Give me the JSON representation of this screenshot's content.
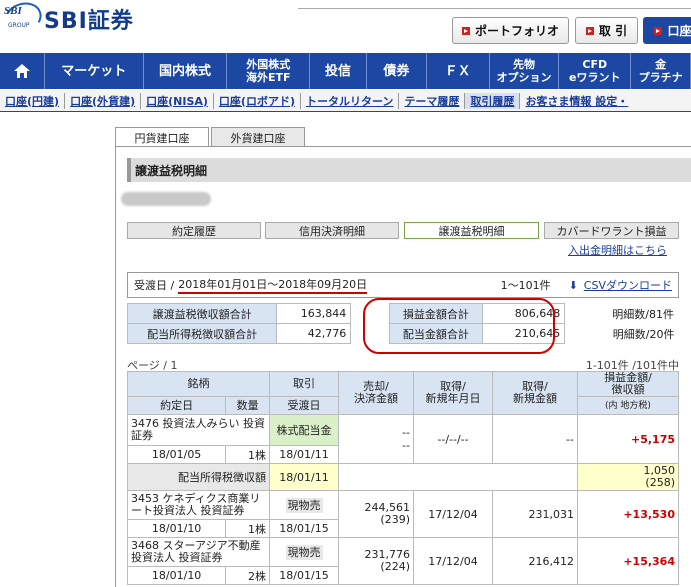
{
  "header": {
    "logo_small": "SBI",
    "logo_group": "GROUP",
    "logo_main": "SBI証券",
    "buttons": [
      {
        "label": "ポートフォリオ"
      },
      {
        "label": "取 引"
      },
      {
        "label": "口座"
      }
    ]
  },
  "nav": [
    "マーケット",
    "国内株式",
    "外国株式\n海外ETF",
    "投信",
    "債券",
    "ＦＸ",
    "先物\nオプション",
    "CFD\neワラント",
    "金\nプラチナ"
  ],
  "subnav": [
    "口座(円建)",
    "口座(外貨建)",
    "口座(NISA)",
    "口座(ロボアド)",
    "トータルリターン",
    "テーマ履歴",
    "取引履歴",
    "お客さま情報 設定・"
  ],
  "tabs": {
    "yen": "円貨建口座",
    "foreign": "外貨建口座"
  },
  "section_title": "譲渡益税明細",
  "subtabs": [
    "約定履歴",
    "信用決済明細",
    "譲渡益税明細",
    "カバードワラント損益"
  ],
  "deposit_link": "入出金明細はこちら",
  "filter": {
    "label": "受渡日 /",
    "range": "2018年01月01日〜2018年09月20日",
    "count": "1〜101件",
    "csv": "CSVダウンロード"
  },
  "summary": {
    "row1": {
      "l1": "譲渡益税徴収額合計",
      "v1": "163,844",
      "l2": "損益金額合計",
      "v2": "806,648",
      "d": "明細数/81件"
    },
    "row2": {
      "l1": "配当所得税徴収額合計",
      "v1": "42,776",
      "l2": "配当金額合計",
      "v2": "210,645",
      "d": "明細数/20件"
    }
  },
  "paging": {
    "page": "ページ / 1",
    "range": "1-101件 /101件中"
  },
  "table": {
    "h_meigara": "銘柄",
    "h_torihiki": "取引",
    "h_baikyaku": "売却/\n決済金額",
    "h_shutoku_date": "取得/\n新規年月日",
    "h_shutoku_amt": "取得/\n新規金額",
    "h_soneki": "損益金額/\n徴収額",
    "h_yakujo": "約定日",
    "h_suryo": "数量",
    "h_ukewatashi": "受渡日",
    "h_hiyo": "(費用)",
    "h_uchi": "(内 地方税)",
    "rows": [
      {
        "name": "3476 投資法人みらい 投資証券",
        "tr": "株式配当金",
        "sell": "--\n--",
        "acqd": "--/--/--",
        "acqa": "--",
        "pl": "+5,175",
        "date": "18/01/05",
        "qty": "1株",
        "ud": "18/01/11"
      },
      {
        "tax_label": "配当所得税徴収額",
        "tax_date": "18/01/11",
        "tax_val": "1,050\n(258)"
      },
      {
        "name": "3453 ケネディクス商業リート投資法人 投資証券",
        "tr": "現物売",
        "sell": "244,561\n(239)",
        "acqd": "17/12/04",
        "acqa": "231,031",
        "pl": "+13,530",
        "date": "18/01/10",
        "qty": "1株",
        "ud": "18/01/15"
      },
      {
        "name": "3468 スターアジア不動産投資法人 投資証券",
        "tr": "現物売",
        "sell": "231,776\n(224)",
        "acqd": "17/12/04",
        "acqa": "216,412",
        "pl": "+15,364",
        "date": "18/01/10",
        "qty": "2株",
        "ud": "18/01/15"
      }
    ]
  }
}
